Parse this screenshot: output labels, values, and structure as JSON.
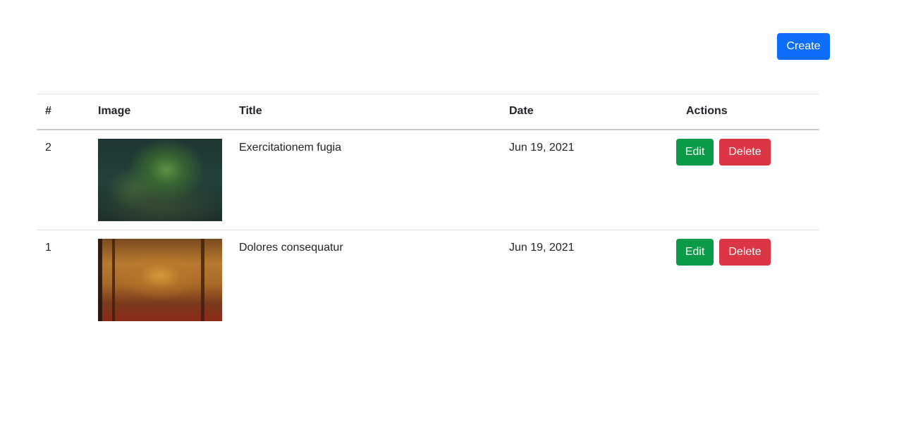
{
  "toolbar": {
    "create_label": "Create"
  },
  "table": {
    "headers": {
      "num": "#",
      "image": "Image",
      "title": "Title",
      "date": "Date",
      "actions": "Actions"
    },
    "rows": [
      {
        "num": "2",
        "image_icon": "forest-green-image",
        "title": "Exercitationem fugia",
        "date": "Jun 19, 2021",
        "edit_label": "Edit",
        "delete_label": "Delete"
      },
      {
        "num": "1",
        "image_icon": "forest-autumn-image",
        "title": "Dolores consequatur",
        "date": "Jun 19, 2021",
        "edit_label": "Edit",
        "delete_label": "Delete"
      }
    ]
  },
  "colors": {
    "primary": "#0d6efd",
    "success": "#0a9a48",
    "danger": "#dc3545"
  }
}
